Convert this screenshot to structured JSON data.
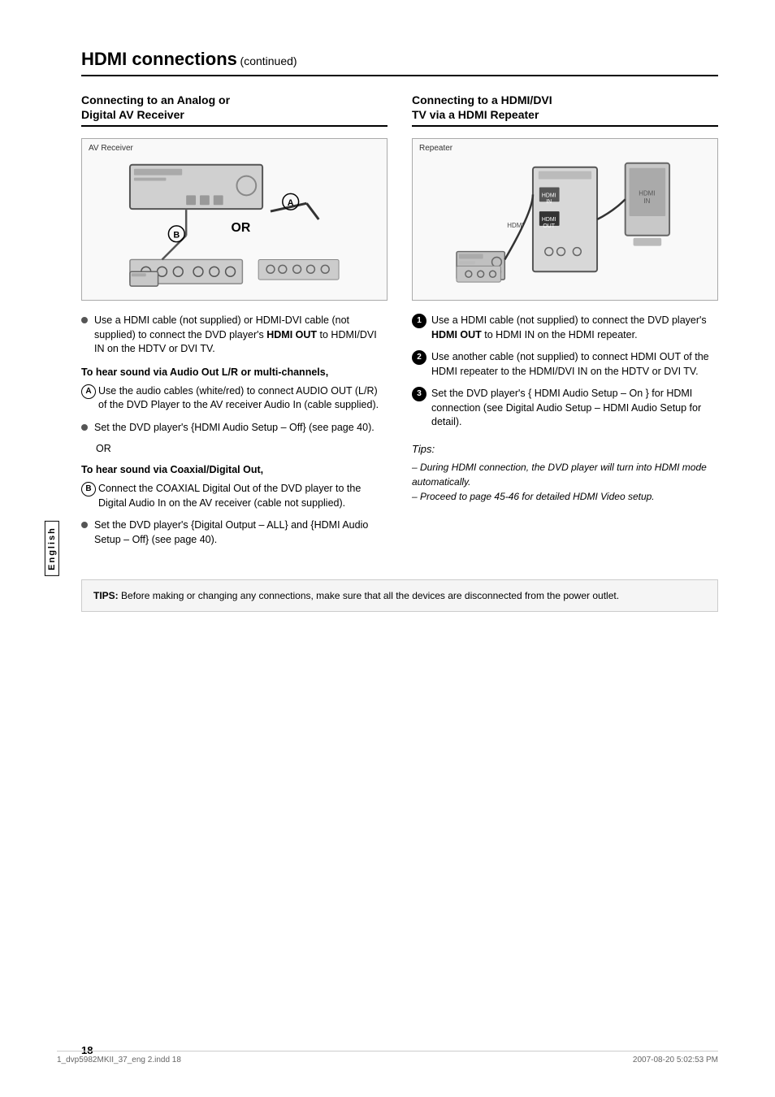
{
  "page": {
    "title": "HDMI connections",
    "title_continued": "(continued)",
    "sidebar_label": "English",
    "page_number": "18",
    "footer_left": "1_dvp5982MKII_37_eng 2.indd   18",
    "footer_right": "2007-08-20   5:02:53 PM"
  },
  "left_section": {
    "title": "Connecting to an Analog or\nDigital AV Receiver",
    "diagram_label": "AV Receiver",
    "or_text": "OR",
    "bullet1": "Use a HDMI cable (not supplied) or HDMI-DVI cable (not supplied) to connect the DVD player's ",
    "bullet1_bold": "HDMI OUT",
    "bullet1_rest": " to HDMI/DVI IN on the HDTV or DVI TV.",
    "subheader1": "To hear sound via Audio Out L/R or multi-channels,",
    "bullet_a": "Use the audio cables (white/red) to connect AUDIO OUT (L/R) of the DVD Player to the AV receiver Audio In (cable supplied).",
    "bullet2": "Set the DVD player's {HDMI Audio Setup – Off} (see page 40).",
    "or_label": "OR",
    "subheader2": "To hear sound via Coaxial/Digital Out,",
    "bullet_b": "Connect the COAXIAL Digital Out of the DVD player to the Digital Audio In on the AV receiver (cable not supplied).",
    "bullet3": "Set the DVD player's {Digital Output – ALL} and {HDMI Audio Setup – Off} (see page 40)."
  },
  "right_section": {
    "title": "Connecting to a HDMI/DVI\nTV via a HDMI Repeater",
    "diagram_label": "Repeater",
    "step1": "Use a HDMI cable (not supplied) to connect the DVD player's ",
    "step1_bold": "HDMI OUT",
    "step1_rest": " to HDMI IN on the HDMI repeater.",
    "step2": "Use another cable (not supplied) to connect HDMI OUT of the HDMI repeater to the HDMI/DVI IN on the HDTV or DVI TV.",
    "step3_pre": "Set the DVD player's { HDMI Audio Setup – On } for HDMI connection (see Digital Audio Setup – HDMI Audio Setup for detail).",
    "tips_title": "Tips:",
    "tips_line1": "– During HDMI connection, the DVD player will turn into HDMI mode automatically.",
    "tips_line2": "– Proceed to page 45-46 for detailed HDMI Video setup."
  },
  "tips_box": {
    "label": "TIPS:",
    "text": "Before making or changing any connections, make sure that all the devices are disconnected from the power outlet."
  }
}
